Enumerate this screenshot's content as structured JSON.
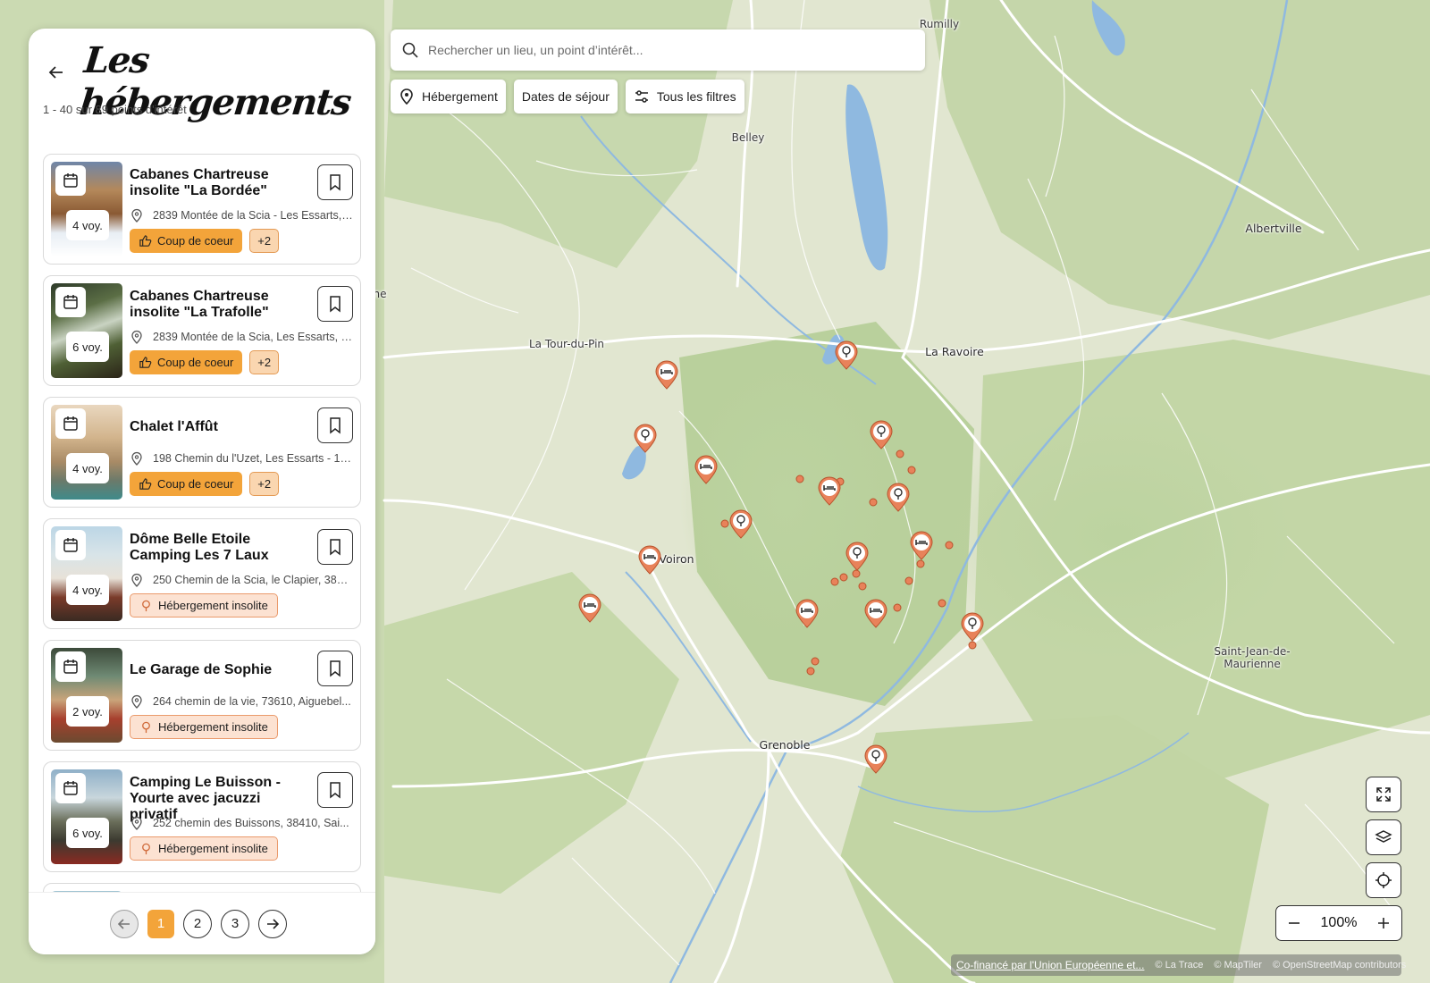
{
  "search": {
    "placeholder": "Rechercher un lieu, un point d’intérêt..."
  },
  "filters": [
    {
      "label": "Hébergement",
      "icon": "location-pin-icon"
    },
    {
      "label": "Dates de séjour"
    },
    {
      "label": "Tous les filtres",
      "icon": "sliders-icon"
    }
  ],
  "panel": {
    "title": "Les hébergements",
    "result_count": "1 - 40 sur 89 points d'intérêt"
  },
  "cards": [
    {
      "title": "Cabanes Chartreuse insolite \"La Bordée\"",
      "capacity": "4 voy.",
      "address": "2839 Montée de la Scia - Les Essarts, ...",
      "tags": [
        "Coup de coeur",
        "+2"
      ],
      "tag_type": "fav"
    },
    {
      "title": "Cabanes Chartreuse insolite \"La Trafolle\"",
      "capacity": "6 voy.",
      "address": "2839 Montée de la Scia, Les Essarts, 3...",
      "tags": [
        "Coup de coeur",
        "+2"
      ],
      "tag_type": "fav"
    },
    {
      "title": "Chalet l'Affût",
      "capacity": "4 voy.",
      "address": "198 Chemin du l'Uzet, Les Essarts - 13....",
      "tags": [
        "Coup de coeur",
        "+2"
      ],
      "tag_type": "fav"
    },
    {
      "title": "Dôme Belle Etoile Camping Les 7 Laux",
      "capacity": "4 voy.",
      "address": "250 Chemin de la Scia, le Clapier, 3857...",
      "tags": [
        "Hébergement insolite"
      ],
      "tag_type": "insolite"
    },
    {
      "title": "Le Garage de Sophie",
      "capacity": "2 voy.",
      "address": "264 chemin de la vie, 73610, Aiguebel...",
      "tags": [
        "Hébergement insolite"
      ],
      "tag_type": "insolite"
    },
    {
      "title": "Camping Le Buisson - Yourte avec jacuzzi privatif",
      "capacity": "6 voy.",
      "address": "252 chemin des Buissons, 38410, Sai...",
      "tags": [
        "Hébergement insolite"
      ],
      "tag_type": "insolite"
    }
  ],
  "pagination": {
    "pages": [
      "1",
      "2",
      "3"
    ],
    "current": "1"
  },
  "map": {
    "zoom_label": "100%",
    "places": [
      "Rumilly",
      "Belley",
      "Albertville",
      "La Tour-du-Pin",
      "La Ravoire",
      "Voiron",
      "Grenoble",
      "Saint-Jean-de-\nMaurienne",
      "ne"
    ],
    "attribution": {
      "funding": "Co-financé par l'Union Européenne et...",
      "sources": [
        "© La Trace",
        "© MapTiler",
        "© OpenStreetMap contributors"
      ]
    }
  },
  "colors": {
    "accent": "#f3a43a",
    "pin": "#e8825a",
    "pin_dark": "#b8532c",
    "water": "#8fb9e0"
  }
}
